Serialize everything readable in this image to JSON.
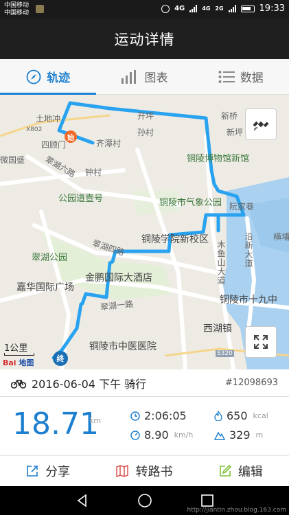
{
  "status_bar": {
    "carrier_1": "中国移动",
    "carrier_2": "中国移动",
    "net_1": "4G",
    "net_2": "4G",
    "net_3": "2G",
    "time": "19:33"
  },
  "title": "运动详情",
  "tabs": [
    {
      "label": "轨迹",
      "icon": "compass-icon",
      "active": true
    },
    {
      "label": "图表",
      "icon": "bar-chart-icon",
      "active": false
    },
    {
      "label": "数据",
      "icon": "list-icon",
      "active": false
    }
  ],
  "map": {
    "labels": {
      "tudichong": "土地冲",
      "x802": "X802",
      "simenting": "四顾门",
      "qitancun": "齐潭村",
      "kaigang": "开坪",
      "sunchun": "孙村",
      "xinqiao": "新桥",
      "xinping": "新坪",
      "weiguosheng": "微国盛",
      "cuihuliulu": "翠湖六路",
      "zhongcun": "钟村",
      "museum": "铜陵博物馆新馆",
      "gongyuandao": "公园道壹号",
      "weather": "铜陵市气象公园",
      "ruanjiaxiang": "阮家巷",
      "college": "铜陵学院新校区",
      "hengpu": "横埔",
      "cuihugongyuan": "翠湖公园",
      "cuihusilu": "翠湖四路",
      "mushandadao": "木鱼山大道",
      "yanxindadao": "沿新大道",
      "hotel": "金鹏国际大酒店",
      "jiahua": "嘉华国际广场",
      "cuihuyilu": "翠湖一路",
      "nineteen": "铜陵市十九中",
      "xihuzhen": "西湖镇",
      "hospital": "铜陵市中医医院",
      "s320": "S320",
      "start_marker": "始",
      "end_marker": "终"
    },
    "scale_label": "1公里",
    "provider_1": "Bai",
    "provider_2": "地图",
    "route_color": "#29a3f0"
  },
  "workout": {
    "date_time": "2016-06-04 下午 骑行",
    "record_id": "#12098693",
    "distance": "18.71",
    "distance_unit": "km",
    "duration": "2:06:05",
    "speed": "8.90",
    "speed_unit": "km/h",
    "calories": "650",
    "calories_unit": "kcal",
    "climb": "329",
    "climb_unit": "m"
  },
  "actions": [
    {
      "label": "分享",
      "icon": "share-icon"
    },
    {
      "label": "转路书",
      "icon": "roadbook-icon"
    },
    {
      "label": "编辑",
      "icon": "edit-icon"
    }
  ],
  "watermark": "http://jiantin.zhou.blog.163.com",
  "colors": {
    "accent": "#1d7fcf",
    "topbar": "#1f1f1f",
    "route": "#29a3f0",
    "start_marker": "#f06a2a",
    "end_marker": "#1a6fb5"
  }
}
